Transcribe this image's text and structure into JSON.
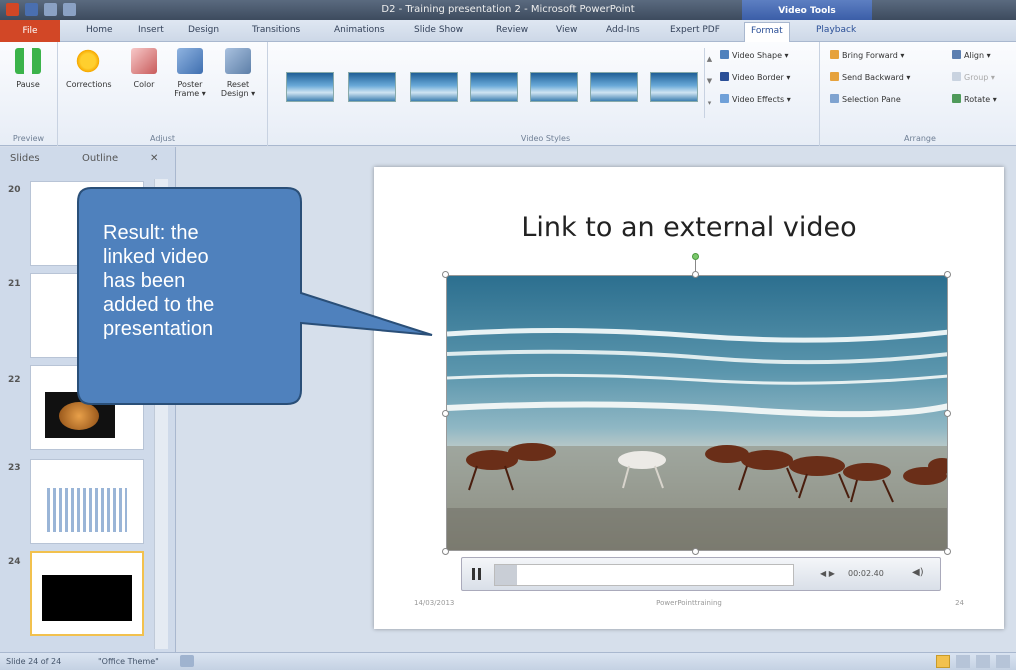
{
  "window": {
    "title": "D2 - Training presentation 2 - Microsoft PowerPoint",
    "context_tab_group": "Video Tools"
  },
  "ribbon": {
    "tabs": [
      "File",
      "Home",
      "Insert",
      "Design",
      "Transitions",
      "Animations",
      "Slide Show",
      "Review",
      "View",
      "Add-Ins",
      "Expert PDF",
      "Format",
      "Playback"
    ],
    "active_tab": "Format",
    "groups": {
      "preview": {
        "label": "Preview",
        "pause": "Pause"
      },
      "adjust": {
        "label": "Adjust",
        "corrections": "Corrections",
        "color": "Color",
        "poster_frame_1": "Poster",
        "poster_frame_2": "Frame",
        "reset_design_1": "Reset",
        "reset_design_2": "Design"
      },
      "video_styles": {
        "label": "Video Styles",
        "video_shape": "Video Shape",
        "video_border": "Video Border",
        "video_effects": "Video Effects"
      },
      "arrange": {
        "label": "Arrange",
        "bring_forward": "Bring Forward",
        "send_backward": "Send Backward",
        "selection_pane": "Selection Pane",
        "align": "Align",
        "group": "Group",
        "rotate": "Rotate"
      }
    }
  },
  "left_pane": {
    "tabs": [
      "Slides",
      "Outline"
    ],
    "close": "✕",
    "slides": [
      {
        "num": "20"
      },
      {
        "num": "21"
      },
      {
        "num": "22"
      },
      {
        "num": "23"
      },
      {
        "num": "24"
      }
    ]
  },
  "slide": {
    "title": "Link to an external video",
    "video": {
      "time": "00:02.40"
    },
    "footer_date": "14/03/2013",
    "footer_text": "PowerPointtraining",
    "footer_num": "24"
  },
  "callout": {
    "lines": [
      "Result: the",
      "linked video",
      "has been",
      "added to the",
      "presentation"
    ],
    "fill": "#4f81bd",
    "border": "#2a4f78"
  },
  "statusbar": {
    "slide_info": "Slide 24 of 24",
    "theme": "\"Office Theme\""
  }
}
